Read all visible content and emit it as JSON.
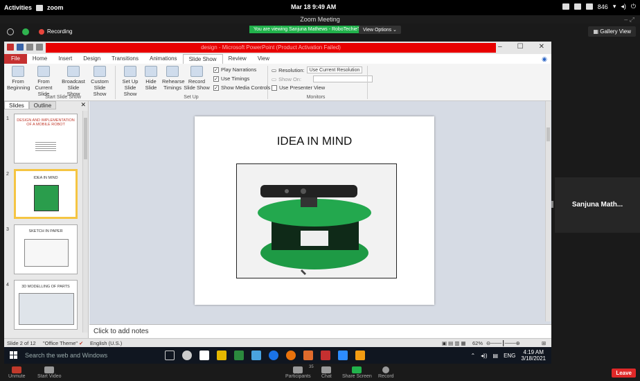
{
  "system": {
    "activities": "Activities",
    "app": "zoom",
    "datetime": "Mar 18  9:49 AM",
    "battery": "846"
  },
  "zoom": {
    "window_title": "Zoom Meeting",
    "recording": "Recording",
    "viewing_banner": "You are viewing Sanjuna Mathews - RoboTechieTips's screen",
    "view_options": "View Options ⌄",
    "gallery_view": "Gallery View",
    "participant_name": "Sanjuna Math...",
    "toolbar": [
      {
        "label": "Unmute"
      },
      {
        "label": "Start Video"
      },
      {
        "label": "Participants",
        "badge": "35"
      },
      {
        "label": "Chat"
      },
      {
        "label": "Share Screen"
      },
      {
        "label": "Record"
      }
    ],
    "leave": "Leave",
    "accent_green": "#22b24c",
    "leave_red": "#e02828"
  },
  "ppt": {
    "title_bar": "design - Microsoft PowerPoint (Product Activation Failed)",
    "tabs": [
      "File",
      "Home",
      "Insert",
      "Design",
      "Transitions",
      "Animations",
      "Slide Show",
      "Review",
      "View"
    ],
    "active_tab": "Slide Show",
    "ribbon": {
      "from_beginning": "From Beginning",
      "from_current": "From Current Slide",
      "broadcast": "Broadcast Slide Show",
      "custom": "Custom Slide Show",
      "start_group": "Start Slide Show",
      "setup_show": "Set Up Slide Show",
      "hide_slide": "Hide Slide",
      "rehearse": "Rehearse Timings",
      "record_slide": "Record Slide Show",
      "play_narrations": "Play Narrations",
      "use_timings": "Use Timings",
      "show_media": "Show Media Controls",
      "setup_group": "Set Up",
      "resolution_label": "Resolution:",
      "resolution_value": "Use Current Resolution",
      "show_on": "Show On:",
      "presenter_view": "Use Presenter View",
      "monitors_group": "Monitors"
    },
    "panel_tabs": [
      "Slides",
      "Outline"
    ],
    "thumbnails": [
      {
        "num": "1",
        "title": "DESIGN AND IMPLEMENTATION OF A MOBILE ROBOT"
      },
      {
        "num": "2",
        "title": "IDEA IN MIND"
      },
      {
        "num": "3",
        "title": "SKETCH IN PAPER"
      },
      {
        "num": "4",
        "title": "3D MODELLING OF PARTS"
      }
    ],
    "slide_title": "IDEA IN MIND",
    "notes_placeholder": "Click to add notes",
    "status": {
      "slide": "Slide 2 of 12",
      "theme": "\"Office Theme\"",
      "language": "English (U.S.)",
      "zoom": "62%"
    }
  },
  "taskbar": {
    "search": "Search the web and Windows",
    "lang": "ENG",
    "time": "4:19 AM",
    "date": "3/18/2021"
  }
}
